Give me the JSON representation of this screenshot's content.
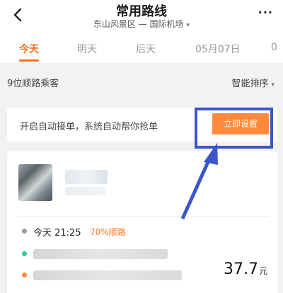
{
  "header": {
    "title": "常用路线",
    "subtitle": "东山风景区 — 国际机场",
    "caret": "▾",
    "more_label": "···"
  },
  "tabs": [
    {
      "label": "今天"
    },
    {
      "label": "明天"
    },
    {
      "label": "后天"
    },
    {
      "label": "05月07日"
    },
    {
      "label": "0"
    }
  ],
  "filter": {
    "passengers": "9位顺路乘客",
    "sort_label": "智能排序",
    "caret": "▾"
  },
  "banner": {
    "text": "开启自动接单，系统自动帮你抢单",
    "button_label": "立即设置"
  },
  "trip": {
    "time": "今天 21:25",
    "route_match": "70%顺路",
    "price": "37.7",
    "currency": "元"
  },
  "colors": {
    "accent": "#ff6a1a",
    "button": "#ff8a3d",
    "annotation": "#3c56c8",
    "start_dot": "#2fc9a0",
    "end_dot": "#ff8a3d"
  }
}
